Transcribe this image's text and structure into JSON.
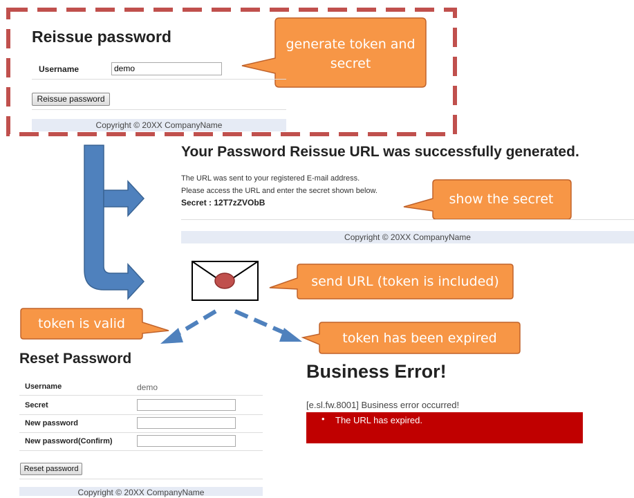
{
  "reissue": {
    "title": "Reissue password",
    "username_label": "Username",
    "username_value": "demo",
    "button_label": "Reissue password",
    "footer": "Copyright © 20XX CompanyName"
  },
  "success": {
    "title": "Your Password Reissue URL was successfully generated.",
    "line1": "The URL was sent to your registered E-mail address.",
    "line2": "Please access the URL and enter the secret shown below.",
    "secret": "Secret : 12T7zZVObB",
    "footer": "Copyright © 20XX CompanyName"
  },
  "reset": {
    "title": "Reset Password",
    "username_label": "Username",
    "username_value": "demo",
    "secret_label": "Secret",
    "new_password_label": "New password",
    "confirm_label": "New password(Confirm)",
    "button_label": "Reset password",
    "footer": "Copyright © 20XX CompanyName"
  },
  "error": {
    "title": "Business Error!",
    "message": "[e.sl.fw.8001] Business error occurred!",
    "detail": "The URL has expired."
  },
  "callouts": {
    "generate": "generate token and secret",
    "show_secret": "show the secret",
    "send_url": "send URL (token is included)",
    "token_valid": "token is valid",
    "token_expired": "token has been expired"
  },
  "colors": {
    "callout_fill": "#f79646",
    "callout_border": "#c0622a",
    "dashed_border": "#c0504d",
    "arrow_blue": "#4f81bd",
    "error_red": "#c00000",
    "footer_bg": "#e6ebf5"
  },
  "icons": {
    "envelope": "envelope-icon"
  }
}
